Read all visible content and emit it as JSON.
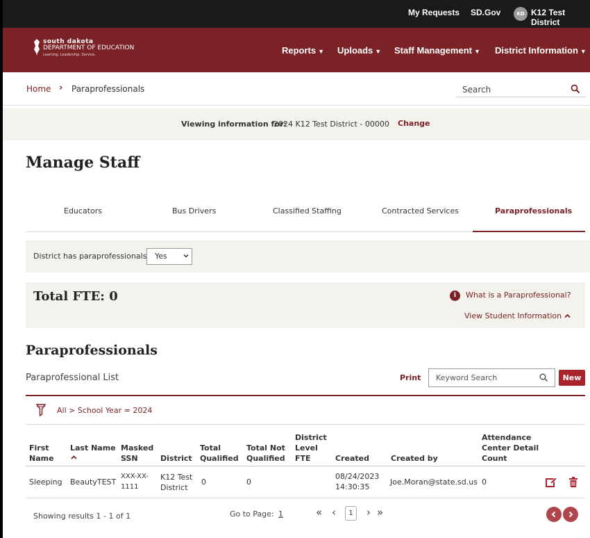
{
  "topbar": {
    "my_requests": "My Requests",
    "sdgov": "SD.Gov",
    "avatar_initials": "KD",
    "user": "K12 Test District"
  },
  "logo": {
    "line1": "south dakota",
    "line2": "DEPARTMENT OF EDUCATION",
    "line3": "Learning. Leadership. Service."
  },
  "nav": {
    "reports": "Reports",
    "uploads": "Uploads",
    "staff_management": "Staff Management",
    "district_information": "District Information"
  },
  "breadcrumb": {
    "home": "Home",
    "current": "Paraprofessionals"
  },
  "search": {
    "placeholder": "Search"
  },
  "viewing": {
    "label": "Viewing information for:",
    "value": "2024 K12 Test District - 00000",
    "change": "Change"
  },
  "page_title": "Manage Staff",
  "tabs": [
    {
      "label": "Educators"
    },
    {
      "label": "Bus Drivers"
    },
    {
      "label": "Classified Staffing"
    },
    {
      "label": "Contracted Services"
    },
    {
      "label": "Paraprofessionals",
      "active": true
    }
  ],
  "has_paras": {
    "label": "District has paraprofessionals",
    "selected": "Yes"
  },
  "fte": {
    "title": "Total FTE: 0",
    "what_link": "What is a Paraprofessional?",
    "view_student": "View Student Information"
  },
  "section_title": "Paraprofessionals",
  "list": {
    "label": "Paraprofessional List",
    "print": "Print",
    "keyword_placeholder": "Keyword Search",
    "new": "New",
    "filter": "All > School Year = 2024"
  },
  "table": {
    "headers": [
      [
        "First",
        "Name"
      ],
      [
        "Last Name"
      ],
      [
        "Masked",
        "SSN"
      ],
      [
        "District"
      ],
      [
        "Total",
        "Qualified"
      ],
      [
        "Total Not",
        "Qualified"
      ],
      [
        "District",
        "Level",
        "FTE"
      ],
      [
        "Created"
      ],
      [
        "Created by"
      ],
      [
        "Attendance",
        "Center Detail",
        "Count"
      ]
    ],
    "rows": [
      {
        "first": "Sleeping",
        "last": "BeautyTEST",
        "ssn": [
          "XXX-XX-",
          "1111"
        ],
        "district": [
          "K12 Test",
          "District"
        ],
        "qualified": "0",
        "not_qualified": "0",
        "fte": "",
        "created": [
          "08/24/2023",
          "14:30:35"
        ],
        "created_by": "Joe.Moran@state.sd.us",
        "count": "0"
      }
    ]
  },
  "pagination": {
    "showing": "Showing results 1 - 1 of 1",
    "goto_label": "Go to Page:",
    "goto_value": "1",
    "current_page": "1"
  },
  "colors": {
    "brand": "#7a2226",
    "topbar": "#1a1a1a",
    "panel": "#f4f2ec",
    "new_button": "#a8232b"
  }
}
